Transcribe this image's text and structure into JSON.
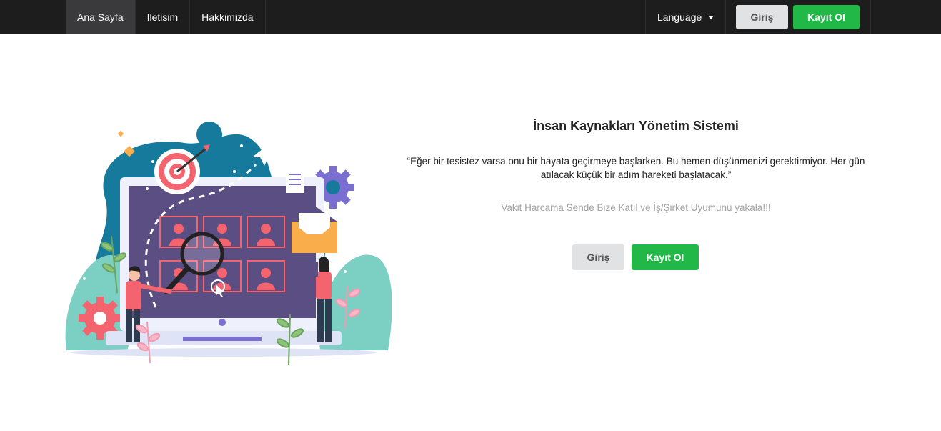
{
  "navbar": {
    "links": [
      {
        "label": "Ana Sayfa",
        "active": true
      },
      {
        "label": "Iletisim",
        "active": false
      },
      {
        "label": "Hakkimizda",
        "active": false
      }
    ],
    "language_label": "Language",
    "login_label": "Giriş",
    "register_label": "Kayıt Ol"
  },
  "hero": {
    "title": "İnsan Kaynakları Yönetim Sistemi",
    "quote": "“Eğer bir tesistez varsa onu bir hayata geçirmeye başlarken. Bu hemen düşünmenizi gerektirmiyor. Her gün atılacak küçük bir adım hareketi başlatacak.”",
    "tagline": "Vakit Harcama Sende Bize Katıl ve İş/Şirket Uyumunu yakala!!!",
    "login_label": "Giriş",
    "register_label": "Kayıt Ol"
  },
  "colors": {
    "navbar_bg": "#1d1d1e",
    "active_tab_bg": "#3a3a3c",
    "primary_green": "#21b848",
    "secondary_gray": "#e1e2e4",
    "blob_teal": "#157a9c",
    "screen_purple": "#5b4e82",
    "accent_coral": "#f4646f"
  },
  "icons": [
    "chevron-down-icon"
  ]
}
